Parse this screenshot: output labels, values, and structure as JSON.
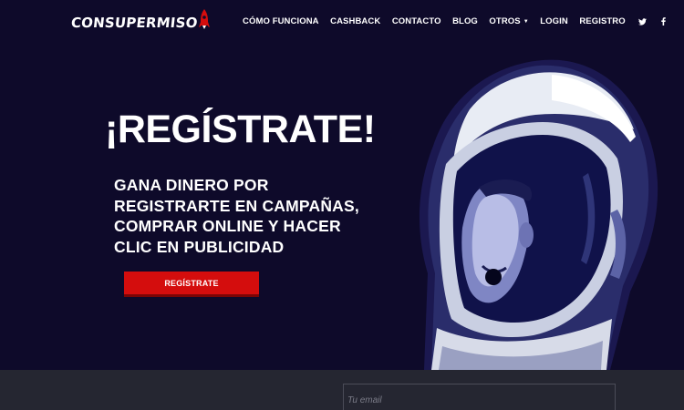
{
  "brand": {
    "logo_text": "CONSUPERMISO",
    "logo_icon": "rocket-icon",
    "accent_color": "#d40d0d"
  },
  "nav": {
    "items": [
      {
        "label": "CÓMO FUNCIONA"
      },
      {
        "label": "CASHBACK"
      },
      {
        "label": "CONTACTO"
      },
      {
        "label": "BLOG"
      },
      {
        "label": "OTROS",
        "dropdown": true
      },
      {
        "label": "LOGIN"
      },
      {
        "label": "REGISTRO"
      }
    ],
    "social": [
      "twitter-icon",
      "facebook-icon"
    ]
  },
  "hero": {
    "title": "¡REGÍSTRATE!",
    "subtitle": "GANA DINERO POR REGISTRARTE EN CAMPAÑAS, COMPRAR ONLINE Y HACER CLIC EN PUBLICIDAD",
    "cta_label": "REGÍSTRATE",
    "image": "astronaut-illustration"
  },
  "signup": {
    "email_placeholder": "Tu email"
  },
  "colors": {
    "background": "#0e0a2a",
    "band": "#252631"
  }
}
